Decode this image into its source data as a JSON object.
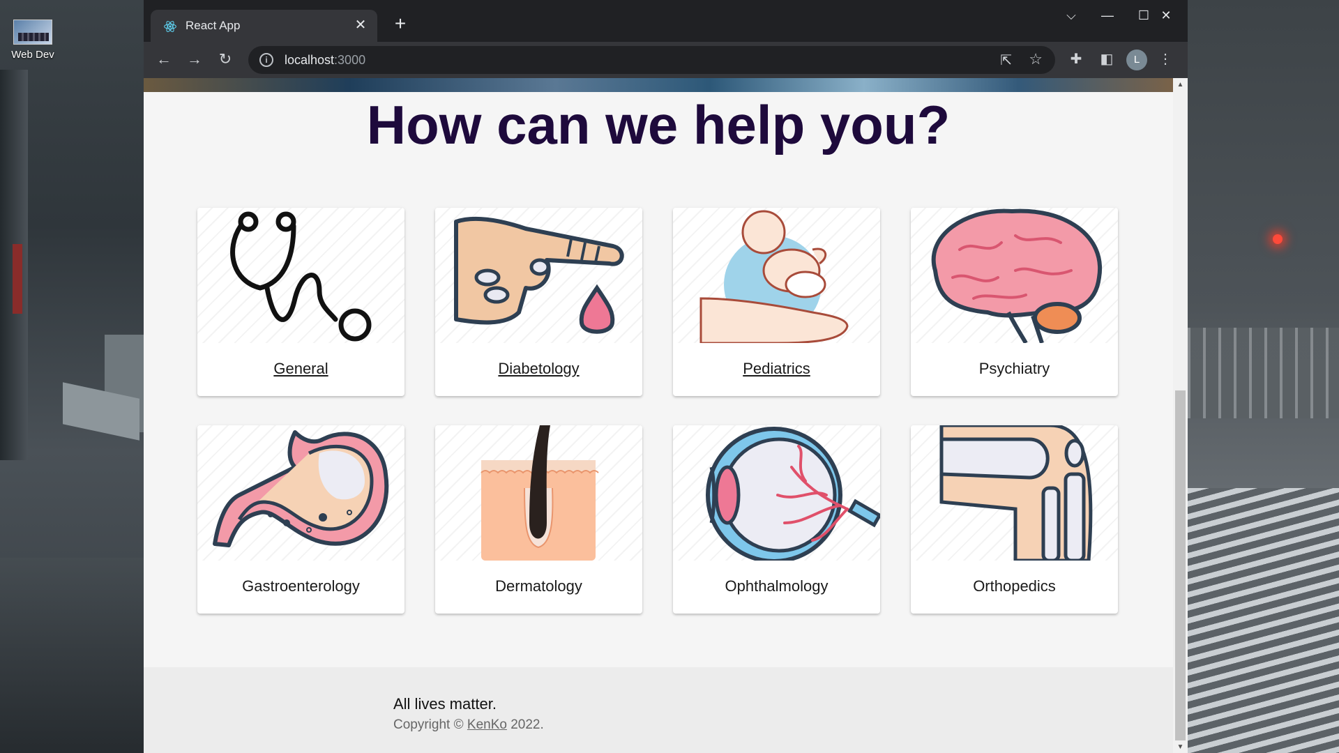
{
  "desktop": {
    "icon_label": "Web Dev"
  },
  "browser": {
    "tab_title": "React App",
    "tab_close": "✕",
    "new_tab": "+",
    "url_host": "localhost",
    "url_port": ":3000",
    "profile_initial": "L",
    "controls": {
      "dropdown": "⌵",
      "minimize": "—",
      "maximize": "☐",
      "close": "✕"
    }
  },
  "page": {
    "heading": "How can we help you?",
    "services": [
      {
        "label": "General",
        "icon": "stethoscope-icon",
        "link": true
      },
      {
        "label": "Diabetology",
        "icon": "blood-drop-finger-icon",
        "link": true
      },
      {
        "label": "Pediatrics",
        "icon": "baby-in-hand-icon",
        "link": true
      },
      {
        "label": "Psychiatry",
        "icon": "brain-icon",
        "link": false
      },
      {
        "label": "Gastroenterology",
        "icon": "stomach-icon",
        "link": false
      },
      {
        "label": "Dermatology",
        "icon": "skin-hair-icon",
        "link": false
      },
      {
        "label": "Ophthalmology",
        "icon": "eye-icon",
        "link": false
      },
      {
        "label": "Orthopedics",
        "icon": "knee-joint-icon",
        "link": false
      }
    ],
    "footer": {
      "message": "All lives matter.",
      "copyright_prefix": "Copyright ©",
      "brand": "KenKo",
      "year_suffix": "2022."
    }
  },
  "colors": {
    "heading": "#1e0a3c",
    "chrome_dark": "#202124",
    "chrome_tab": "#35363a",
    "page_bg": "#f5f5f5"
  }
}
